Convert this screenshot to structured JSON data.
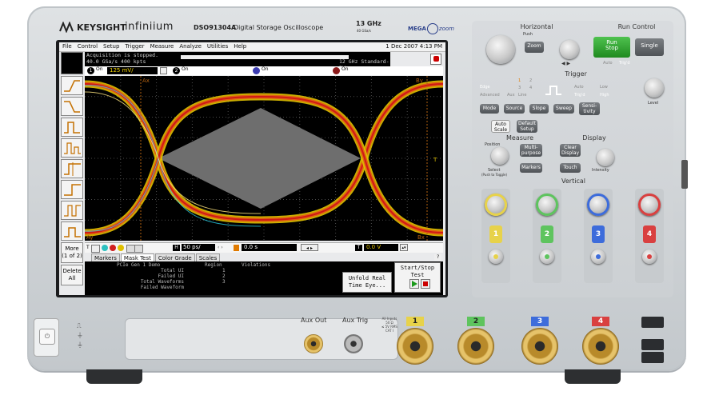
{
  "brand": {
    "company": "KEYSIGHT",
    "product_line": "infiniium",
    "model": "DSO91304A",
    "description": "Digital Storage Oscilloscope",
    "bandwidth": "13 GHz",
    "sample_rate_small": "40 GSa/s",
    "megazoom": "MEGA",
    "megazoom_suffix": "zoom"
  },
  "menu": [
    "File",
    "Control",
    "Setup",
    "Trigger",
    "Measure",
    "Analyze",
    "Utilities",
    "Help"
  ],
  "datetime": "1 Dec 2007  4:13 PM",
  "status": {
    "line1": "Acquisition is stopped.",
    "line2": "40.0 GSa/s    400 kpts",
    "bw": "12 GHz  Standard-BW"
  },
  "channels": [
    {
      "num": "1",
      "state": "On",
      "scale": "125 mV/",
      "color": "#f2d300"
    },
    {
      "num": "2",
      "state": "On",
      "color": "#3bc43b"
    },
    {
      "num": "3",
      "state": "On",
      "color": "#3b6bff"
    },
    {
      "num": "4",
      "state": "On",
      "color": "#e0303a"
    }
  ],
  "markers": {
    "ax": "Ax",
    "bx": "Bx",
    "ay": "Ay",
    "by": "By",
    "trigger": "T"
  },
  "sidebar": {
    "more": "More",
    "more_sub": "(1 of 2)",
    "delete": "Delete",
    "delete_sub": "All"
  },
  "timebase": {
    "scale": "50 ps/",
    "delay": "0.0 s",
    "trig_level": "0.0 V",
    "h_label": "H",
    "t_label": "T"
  },
  "tabs": [
    "Markers",
    "Mask Test",
    "Color Grade",
    "Scales"
  ],
  "results": {
    "title": "PCIe Gen 1 Demo",
    "col_region": "Region",
    "col_violations": "Violations",
    "rows": [
      {
        "label": "Total UI",
        "value": "1"
      },
      {
        "label": "Failed UI",
        "value": "2"
      },
      {
        "label": "Total Waveforms",
        "value": "3"
      },
      {
        "label": "Failed Waveform",
        "value": ""
      }
    ],
    "unfold": "Unfold Real\nTime Eye...",
    "startstop": "Start/Stop Test",
    "help": "?"
  },
  "panel": {
    "horizontal": "Horizontal",
    "push_label": "Push",
    "zoom": "Zoom",
    "run_control": "Run Control",
    "run_stop": "Run\nStop",
    "single": "Single",
    "auto": "Auto",
    "trig_d": "Trig'd",
    "trigger": "Trigger",
    "edge": "Edge",
    "advanced": "Advanced",
    "aux": "Aux",
    "line": "Line",
    "src_nums": [
      "1",
      "2",
      "3",
      "4"
    ],
    "trig_auto": "Auto",
    "trig_trigd": "Trig'd",
    "low": "Low",
    "high": "High",
    "mode": "Mode",
    "source": "Source",
    "slope": "Slope",
    "sweep": "Sweep",
    "sensitivity": "Sensi-\ntivity",
    "level": "Level",
    "autoscale": "Auto\nScale",
    "default_setup": "Default\nSetup",
    "measure": "Measure",
    "position": "Position",
    "select": "Select",
    "push_to_toggle": "(Push to Toggle)",
    "multipurpose": "Multi-\npurpose",
    "markers": "Markers",
    "display": "Display",
    "clear_display": "Clear\nDisplay",
    "touch": "Touch",
    "intensity": "Intensity",
    "vertical": "Vertical",
    "chan_nums": [
      "1",
      "2",
      "3",
      "4"
    ]
  },
  "front": {
    "aux_out": "Aux Out",
    "aux_trig": "Aux Trig",
    "inputs": [
      "1",
      "2",
      "3",
      "4"
    ],
    "input_spec": "All Inputs\n50 Ω\n≤ 5V RMS\nCAT I",
    "input_colors": [
      "#e7d24a",
      "#5ec45e",
      "#3d6cdb",
      "#d94040"
    ]
  },
  "colors": {
    "eye_outer": "#e0c000",
    "eye_mid": "#e06010",
    "eye_inner": "#d01818",
    "mask": "#6e6e6e",
    "grid": "#4a4a4a",
    "ax_marker": "#b06010",
    "trace_cyan": "#2ee6ff"
  }
}
